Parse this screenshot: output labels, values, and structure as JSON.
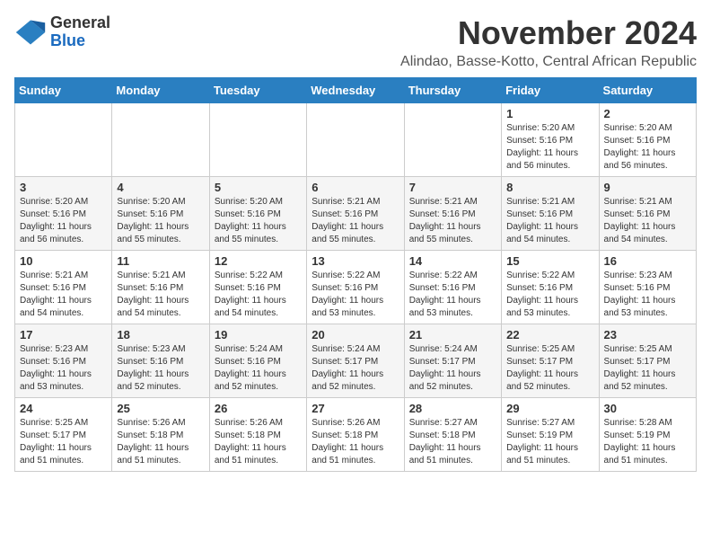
{
  "logo": {
    "general": "General",
    "blue": "Blue"
  },
  "header": {
    "month": "November 2024",
    "location": "Alindao, Basse-Kotto, Central African Republic"
  },
  "days_of_week": [
    "Sunday",
    "Monday",
    "Tuesday",
    "Wednesday",
    "Thursday",
    "Friday",
    "Saturday"
  ],
  "weeks": [
    [
      {
        "day": "",
        "info": ""
      },
      {
        "day": "",
        "info": ""
      },
      {
        "day": "",
        "info": ""
      },
      {
        "day": "",
        "info": ""
      },
      {
        "day": "",
        "info": ""
      },
      {
        "day": "1",
        "info": "Sunrise: 5:20 AM\nSunset: 5:16 PM\nDaylight: 11 hours and 56 minutes."
      },
      {
        "day": "2",
        "info": "Sunrise: 5:20 AM\nSunset: 5:16 PM\nDaylight: 11 hours and 56 minutes."
      }
    ],
    [
      {
        "day": "3",
        "info": "Sunrise: 5:20 AM\nSunset: 5:16 PM\nDaylight: 11 hours and 56 minutes."
      },
      {
        "day": "4",
        "info": "Sunrise: 5:20 AM\nSunset: 5:16 PM\nDaylight: 11 hours and 55 minutes."
      },
      {
        "day": "5",
        "info": "Sunrise: 5:20 AM\nSunset: 5:16 PM\nDaylight: 11 hours and 55 minutes."
      },
      {
        "day": "6",
        "info": "Sunrise: 5:21 AM\nSunset: 5:16 PM\nDaylight: 11 hours and 55 minutes."
      },
      {
        "day": "7",
        "info": "Sunrise: 5:21 AM\nSunset: 5:16 PM\nDaylight: 11 hours and 55 minutes."
      },
      {
        "day": "8",
        "info": "Sunrise: 5:21 AM\nSunset: 5:16 PM\nDaylight: 11 hours and 54 minutes."
      },
      {
        "day": "9",
        "info": "Sunrise: 5:21 AM\nSunset: 5:16 PM\nDaylight: 11 hours and 54 minutes."
      }
    ],
    [
      {
        "day": "10",
        "info": "Sunrise: 5:21 AM\nSunset: 5:16 PM\nDaylight: 11 hours and 54 minutes."
      },
      {
        "day": "11",
        "info": "Sunrise: 5:21 AM\nSunset: 5:16 PM\nDaylight: 11 hours and 54 minutes."
      },
      {
        "day": "12",
        "info": "Sunrise: 5:22 AM\nSunset: 5:16 PM\nDaylight: 11 hours and 54 minutes."
      },
      {
        "day": "13",
        "info": "Sunrise: 5:22 AM\nSunset: 5:16 PM\nDaylight: 11 hours and 53 minutes."
      },
      {
        "day": "14",
        "info": "Sunrise: 5:22 AM\nSunset: 5:16 PM\nDaylight: 11 hours and 53 minutes."
      },
      {
        "day": "15",
        "info": "Sunrise: 5:22 AM\nSunset: 5:16 PM\nDaylight: 11 hours and 53 minutes."
      },
      {
        "day": "16",
        "info": "Sunrise: 5:23 AM\nSunset: 5:16 PM\nDaylight: 11 hours and 53 minutes."
      }
    ],
    [
      {
        "day": "17",
        "info": "Sunrise: 5:23 AM\nSunset: 5:16 PM\nDaylight: 11 hours and 53 minutes."
      },
      {
        "day": "18",
        "info": "Sunrise: 5:23 AM\nSunset: 5:16 PM\nDaylight: 11 hours and 52 minutes."
      },
      {
        "day": "19",
        "info": "Sunrise: 5:24 AM\nSunset: 5:16 PM\nDaylight: 11 hours and 52 minutes."
      },
      {
        "day": "20",
        "info": "Sunrise: 5:24 AM\nSunset: 5:17 PM\nDaylight: 11 hours and 52 minutes."
      },
      {
        "day": "21",
        "info": "Sunrise: 5:24 AM\nSunset: 5:17 PM\nDaylight: 11 hours and 52 minutes."
      },
      {
        "day": "22",
        "info": "Sunrise: 5:25 AM\nSunset: 5:17 PM\nDaylight: 11 hours and 52 minutes."
      },
      {
        "day": "23",
        "info": "Sunrise: 5:25 AM\nSunset: 5:17 PM\nDaylight: 11 hours and 52 minutes."
      }
    ],
    [
      {
        "day": "24",
        "info": "Sunrise: 5:25 AM\nSunset: 5:17 PM\nDaylight: 11 hours and 51 minutes."
      },
      {
        "day": "25",
        "info": "Sunrise: 5:26 AM\nSunset: 5:18 PM\nDaylight: 11 hours and 51 minutes."
      },
      {
        "day": "26",
        "info": "Sunrise: 5:26 AM\nSunset: 5:18 PM\nDaylight: 11 hours and 51 minutes."
      },
      {
        "day": "27",
        "info": "Sunrise: 5:26 AM\nSunset: 5:18 PM\nDaylight: 11 hours and 51 minutes."
      },
      {
        "day": "28",
        "info": "Sunrise: 5:27 AM\nSunset: 5:18 PM\nDaylight: 11 hours and 51 minutes."
      },
      {
        "day": "29",
        "info": "Sunrise: 5:27 AM\nSunset: 5:19 PM\nDaylight: 11 hours and 51 minutes."
      },
      {
        "day": "30",
        "info": "Sunrise: 5:28 AM\nSunset: 5:19 PM\nDaylight: 11 hours and 51 minutes."
      }
    ]
  ]
}
